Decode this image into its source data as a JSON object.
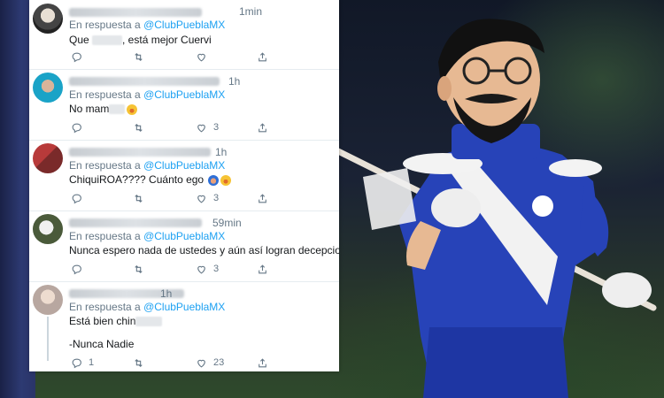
{
  "reply_prefix": "En respuesta a",
  "tweets": [
    {
      "time": "1min",
      "handle": "@ClubPueblaMX",
      "text_parts": [
        "Que ",
        ", está mejor Cuervi"
      ],
      "replies": "",
      "retweets": "",
      "likes": ""
    },
    {
      "time": "1h",
      "handle": "@ClubPueblaMX",
      "text_parts": [
        "No mam",
        ""
      ],
      "replies": "",
      "retweets": "",
      "likes": "3"
    },
    {
      "time": "1h",
      "handle": "@ClubPueblaMX",
      "text_parts": [
        "ChiquiROA????  Cuánto ego ",
        ""
      ],
      "replies": "",
      "retweets": "",
      "likes": "3"
    },
    {
      "time": "59min",
      "handle": "@ClubPueblaMX",
      "text_parts": [
        "Nunca espero nada de ustedes y aún así logran decepcionarme.",
        ""
      ],
      "replies": "",
      "retweets": "",
      "likes": "3"
    },
    {
      "time": "1h",
      "handle": "@ClubPueblaMX",
      "text_parts": [
        "Está bien chin",
        ""
      ],
      "signature": "-Nunca Nadie",
      "replies": "1",
      "retweets": "",
      "likes": "23"
    }
  ],
  "icons": {
    "reply": "reply-icon",
    "retweet": "retweet-icon",
    "like": "heart-icon",
    "share": "share-icon"
  },
  "colors": {
    "link": "#1da1f2",
    "meta": "#657786",
    "text": "#14171a",
    "mascot_blue": "#2743b8"
  }
}
